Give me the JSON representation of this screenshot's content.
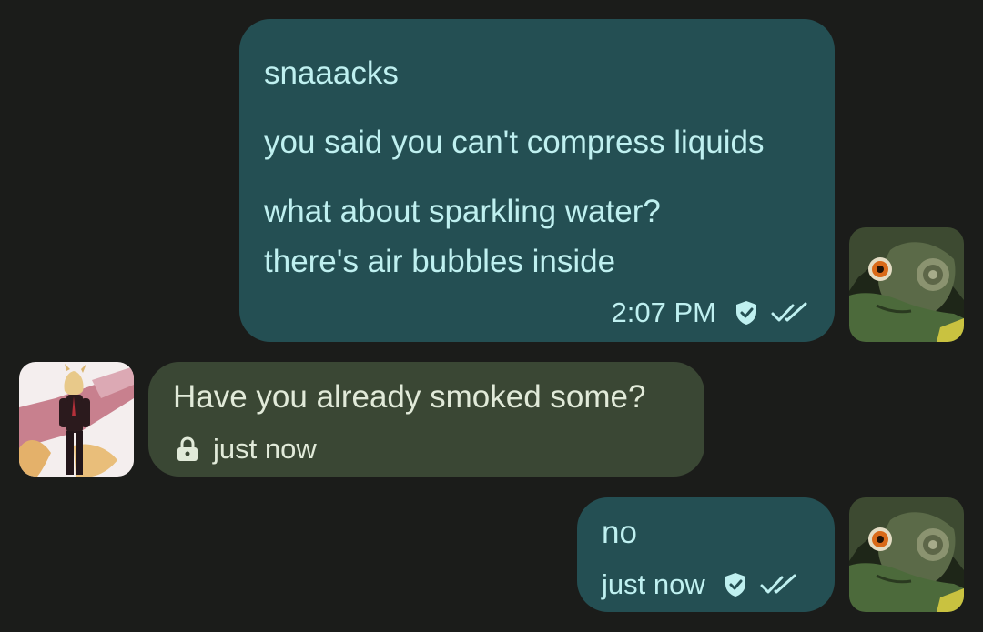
{
  "conversation": {
    "messages": [
      {
        "direction": "outgoing",
        "lines": [
          "snaaacks",
          "you said you can't compress liquids",
          "what about sparkling water?",
          "there's air bubbles inside"
        ],
        "time": "2:07 PM"
      },
      {
        "direction": "incoming",
        "lines": [
          "Have you already smoked some?"
        ],
        "time": "just now"
      },
      {
        "direction": "outgoing",
        "lines": [
          "no"
        ],
        "time": "just now"
      }
    ]
  },
  "icons": {
    "outgoing_verified": "shield-check-icon",
    "outgoing_read": "double-check-icon",
    "incoming_encrypted": "lock-icon"
  },
  "colors": {
    "background": "#1b1c1a",
    "outgoing_bubble": "#244f53",
    "outgoing_text": "#bff0f0",
    "incoming_bubble": "#3a4734",
    "incoming_text": "#e1ead9"
  }
}
